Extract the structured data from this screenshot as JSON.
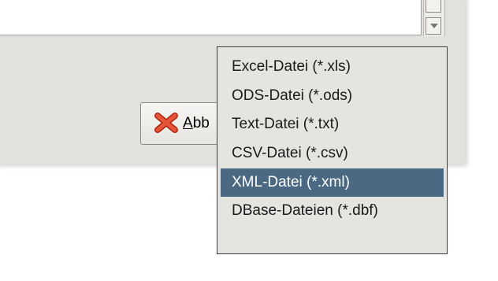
{
  "dialog": {
    "cancel_button": {
      "label_underlined": "A",
      "label_rest": "bb"
    }
  },
  "menu": {
    "items": [
      {
        "label": "Excel-Datei (*.xls)"
      },
      {
        "label": "ODS-Datei (*.ods)"
      },
      {
        "label": "Text-Datei (*.txt)"
      },
      {
        "label": "CSV-Datei (*.csv)"
      },
      {
        "label": "XML-Datei (*.xml)",
        "selected": true
      },
      {
        "label": "DBase-Dateien (*.dbf)"
      }
    ]
  },
  "colors": {
    "selection": "#4b6983",
    "dialog_bg": "#e3e1dd",
    "cancel_icon": "#d33b1e"
  },
  "icons": [
    "scroll-down-arrow-icon",
    "cancel-x-icon"
  ]
}
